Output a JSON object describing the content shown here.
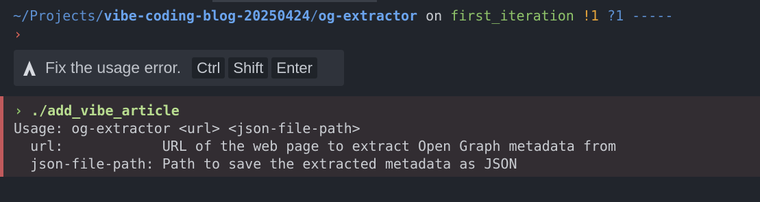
{
  "prompt": {
    "path_prefix": "~/Projects/",
    "repo": "vibe-coding-blog-20250424",
    "separator": "/",
    "dir": "og-extractor",
    "on_word": "on",
    "branch": "first_iteration",
    "modified": "!1",
    "untracked": "?1",
    "trail": "-----",
    "caret": "›"
  },
  "ai_bar": {
    "icon": "warp-ai-icon",
    "text": "Fix the usage error.",
    "keys": [
      "Ctrl",
      "Shift",
      "Enter"
    ]
  },
  "block": {
    "chevron": "›",
    "command": "./add_vibe_article",
    "output": [
      "Usage: og-extractor <url> <json-file-path>",
      "  url:            URL of the web page to extract Open Graph metadata from",
      "  json-file-path: Path to save the extracted metadata as JSON"
    ]
  },
  "colors": {
    "background": "#21252c",
    "error_block_bg": "#322d32",
    "error_bar": "#c05a5c",
    "path_blue": "#5d8fd0",
    "branch_green": "#8fc36a",
    "modified_orange": "#e3a33b",
    "caret_red": "#e0675a"
  }
}
